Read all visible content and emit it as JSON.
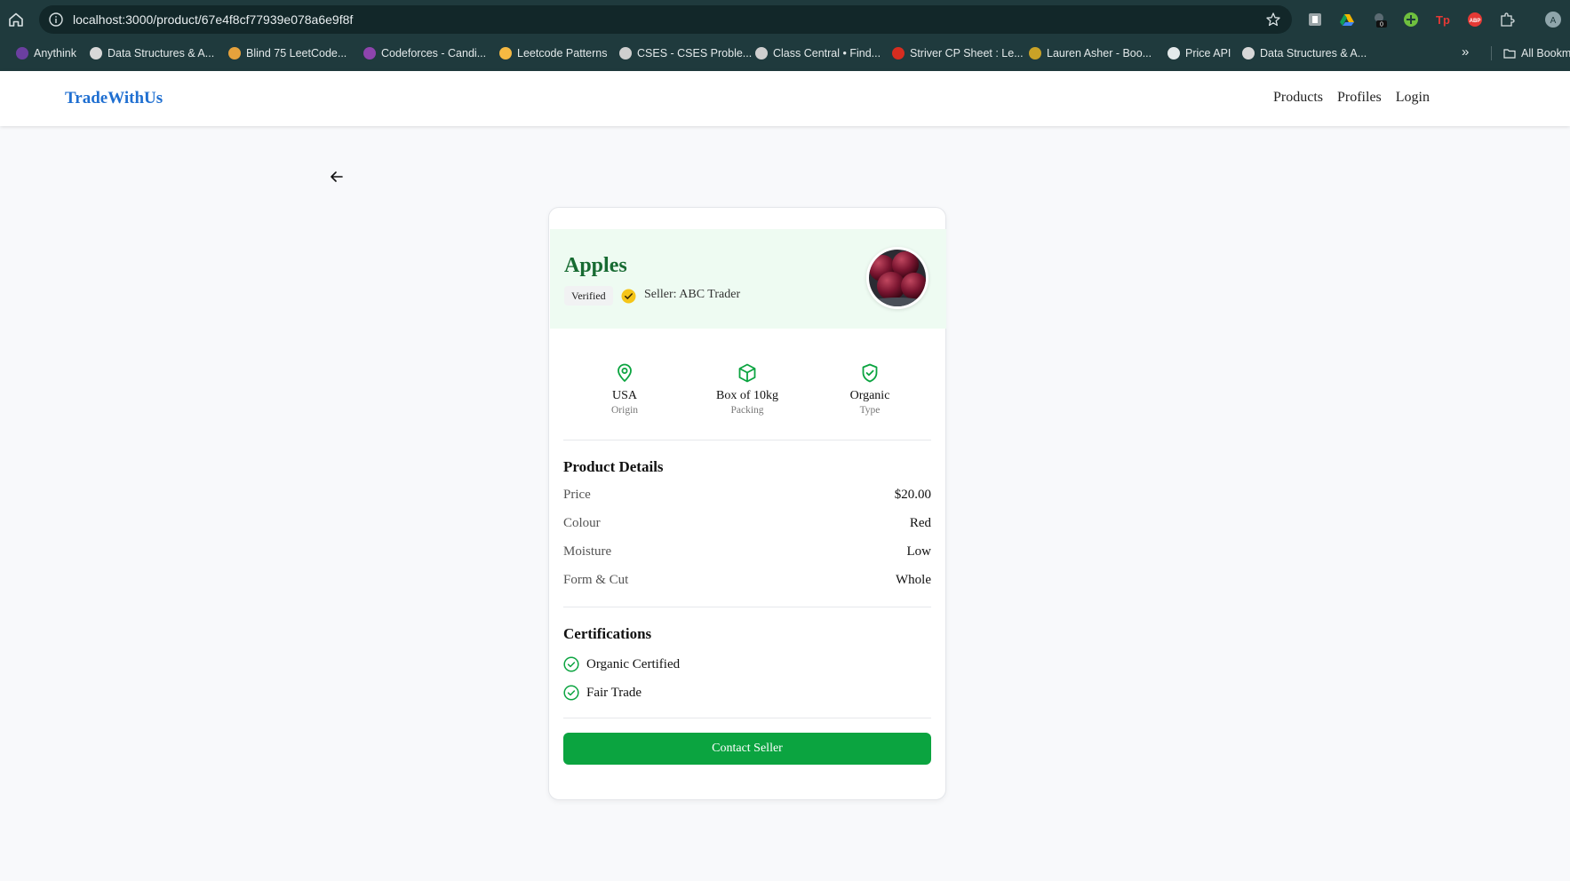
{
  "browser": {
    "url": "localhost:3000/product/67e4f8cf77939e078a6e9f8f",
    "bookmarks": [
      {
        "label": "Anythink",
        "color": "#6b3fa0"
      },
      {
        "label": "Data Structures & A...",
        "color": "#d8d8d8"
      },
      {
        "label": "Blind 75 LeetCode...",
        "color": "#e6a23c"
      },
      {
        "label": "Codeforces - Candi...",
        "color": "#8e44ad"
      },
      {
        "label": "Leetcode Patterns",
        "color": "#f5b942"
      },
      {
        "label": "CSES - CSES Proble...",
        "color": "#cfcfcf"
      },
      {
        "label": "Class Central • Find...",
        "color": "#cfcfcf"
      },
      {
        "label": "Striver CP Sheet : Le...",
        "color": "#d62d20"
      },
      {
        "label": "Lauren Asher - Boo...",
        "color": "#c9a227"
      },
      {
        "label": "Price API",
        "color": "#e3e9ea"
      },
      {
        "label": "Data Structures & A...",
        "color": "#d8d8d8"
      }
    ],
    "more": "»",
    "all_bookmarks": "All Bookm",
    "ext_badge": "0",
    "avatar": "A"
  },
  "nav": {
    "brand": "TradeWithUs",
    "links": [
      "Products",
      "Profiles",
      "Login"
    ]
  },
  "product": {
    "name": "Apples",
    "verified": "Verified",
    "seller": "Seller: ABC Trader",
    "attributes": [
      {
        "value": "USA",
        "label": "Origin",
        "icon": "map-pin-icon"
      },
      {
        "value": "Box of 10kg",
        "label": "Packing",
        "icon": "box-icon"
      },
      {
        "value": "Organic",
        "label": "Type",
        "icon": "shield-check-icon"
      }
    ],
    "details_title": "Product Details",
    "details": [
      {
        "key": "Price",
        "value": "$20.00"
      },
      {
        "key": "Colour",
        "value": "Red"
      },
      {
        "key": "Moisture",
        "value": "Low"
      },
      {
        "key": "Form & Cut",
        "value": "Whole"
      }
    ],
    "certifications_title": "Certifications",
    "certifications": [
      "Organic Certified",
      "Fair Trade"
    ],
    "contact_label": "Contact Seller"
  },
  "colors": {
    "brand": "#1f6fd1",
    "accent_green": "#0ba440",
    "title_green": "#176b32",
    "verified_yellow": "#f5c518"
  }
}
